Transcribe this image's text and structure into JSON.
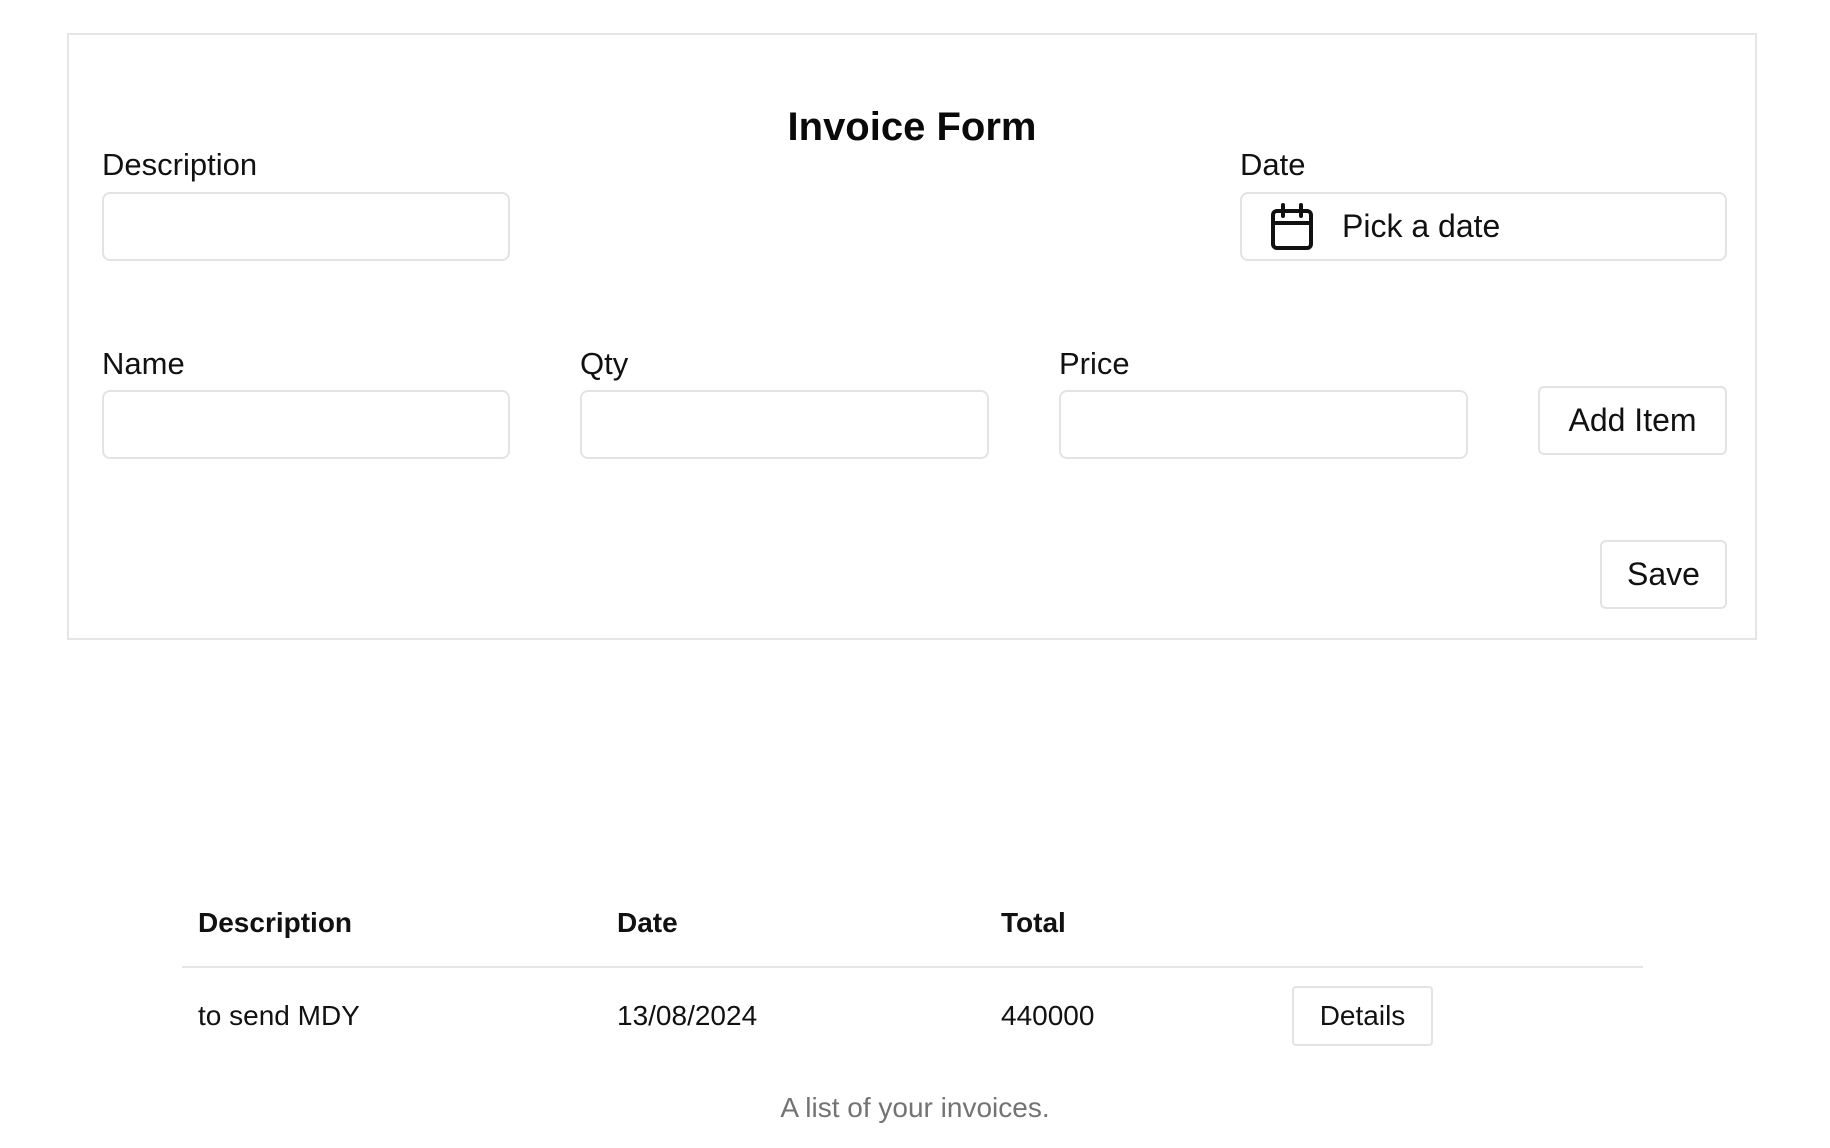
{
  "form": {
    "title": "Invoice Form",
    "description_label": "Description",
    "description_value": "",
    "date_label": "Date",
    "date_placeholder": "Pick a date",
    "date_icon": "calendar-icon",
    "name_label": "Name",
    "name_value": "",
    "qty_label": "Qty",
    "qty_value": "",
    "price_label": "Price",
    "price_value": "",
    "add_item_label": "Add Item",
    "save_label": "Save"
  },
  "table": {
    "headers": [
      "Description",
      "Date",
      "Total",
      ""
    ],
    "rows": [
      {
        "description": "to send MDY",
        "date": "13/08/2024",
        "total": "440000",
        "action_label": "Details"
      }
    ],
    "caption": "A list of your invoices."
  },
  "colors": {
    "border": "#e5e5e5",
    "text": "#111111",
    "muted_text": "#737373",
    "background": "#ffffff"
  }
}
